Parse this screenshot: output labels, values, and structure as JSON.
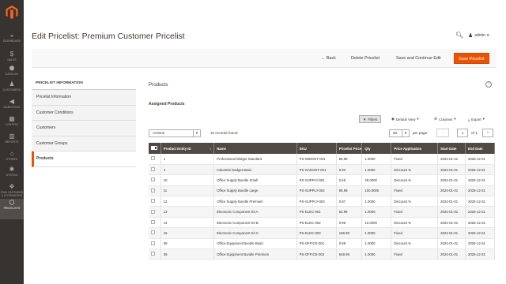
{
  "nav": {
    "items": [
      {
        "label": "Dashboard",
        "icon": "dashboard-icon",
        "glyph": "◒"
      },
      {
        "label": "Sales",
        "icon": "dollar-icon",
        "glyph": "$"
      },
      {
        "label": "Catalog",
        "icon": "cube-icon",
        "glyph": "⬢"
      },
      {
        "label": "Customers",
        "icon": "person-icon",
        "glyph": "♟"
      },
      {
        "label": "Marketing",
        "icon": "megaphone-icon",
        "glyph": "◀"
      },
      {
        "label": "Content",
        "icon": "layout-icon",
        "glyph": "▦"
      },
      {
        "label": "Reports",
        "icon": "bar-chart-icon",
        "glyph": "▥"
      },
      {
        "label": "Stores",
        "icon": "store-icon",
        "glyph": "⌂"
      },
      {
        "label": "System",
        "icon": "gear-icon",
        "glyph": "✱"
      },
      {
        "label": "Find Partners & Extensions",
        "icon": "puzzle-icon",
        "glyph": "❖"
      },
      {
        "label": "Pricelists",
        "icon": "pricelist-icon",
        "glyph": "⬡"
      }
    ],
    "active_index": 10
  },
  "header": {
    "title": "Edit Pricelist: Premium Customer Pricelist",
    "user": "admin"
  },
  "actionbar": {
    "back": "Back",
    "delete": "Delete Pricelist",
    "save_continue": "Save and Continue Edit",
    "save": "Save Pricelist"
  },
  "tabs": {
    "title": "Pricelist Information",
    "items": [
      "Pricelist Information",
      "Customer Conditions",
      "Customers",
      "Customer Groups",
      "Products"
    ],
    "active_index": 4
  },
  "content": {
    "section_title": "Products",
    "subtitle": "Assigned Products",
    "toolbar": {
      "filters": "Filters",
      "view": "Default View",
      "columns": "Columns",
      "export": "Export"
    },
    "actions_label": "Actions",
    "records": "10 records found",
    "per_page": "20",
    "per_page_label": "per page",
    "page": "1",
    "of_pages": "of 1"
  },
  "table": {
    "columns": [
      "Product Entity ID",
      "Name",
      "SKU",
      "Pricelist Price",
      "Qty",
      "Price Application",
      "Start Date",
      "End Date"
    ],
    "rows": [
      [
        "1",
        "Professional Widget Standard",
        "PS-WIDGET-001",
        "85.99",
        "1.0000",
        "Fixed",
        "2024-01-01",
        "2025-12-31"
      ],
      [
        "4",
        "Industrial Gadget Basic",
        "PS-GADGET-001",
        "0.92",
        "1.0000",
        "Discount %",
        "2024-01-01",
        "2025-12-31"
      ],
      [
        "10",
        "Office Supply Bundle Small",
        "PS-SUPPLY-001",
        "0.65",
        "25.0000",
        "Discount %",
        "2024-01-01",
        "2025-12-31"
      ],
      [
        "11",
        "Office Supply Bundle Large",
        "PS-SUPPLY-002",
        "85.99",
        "100.0000",
        "Fixed",
        "2024-01-01",
        "2025-12-31"
      ],
      [
        "12",
        "Office Supply Bundle Premium",
        "PS-SUPPLY-003",
        "0.87",
        "1.0000",
        "Discount %",
        "2024-01-01",
        "2025-12-31"
      ],
      [
        "13",
        "Electronic Component Kit A",
        "PS-ELEC-001",
        "52.99",
        "1.0000",
        "Fixed",
        "2024-01-01",
        "2025-12-31"
      ],
      [
        "14",
        "Electronic Component Kit B",
        "PS-ELEC-002",
        "0.95",
        "10.0000",
        "Discount %",
        "2024-01-01",
        "2025-12-31"
      ],
      [
        "15",
        "Electronic Component Kit C",
        "PS-ELEC-003",
        "169.99",
        "1.0000",
        "Fixed",
        "2024-01-01",
        "2025-12-31"
      ],
      [
        "38",
        "Office Equipment Bundle Basic",
        "PS-OFFICE-001",
        "0.88",
        "1.0000",
        "Discount %",
        "2024-01-01",
        "2025-12-31"
      ],
      [
        "39",
        "Office Equipment Bundle Premium",
        "PS-OFFICE-002",
        "649.99",
        "1.0000",
        "Fixed",
        "2024-01-01",
        "2025-12-31"
      ]
    ]
  },
  "colors": {
    "accent": "#eb5202",
    "nav_bg": "#373330",
    "grid_header": "#514943"
  }
}
